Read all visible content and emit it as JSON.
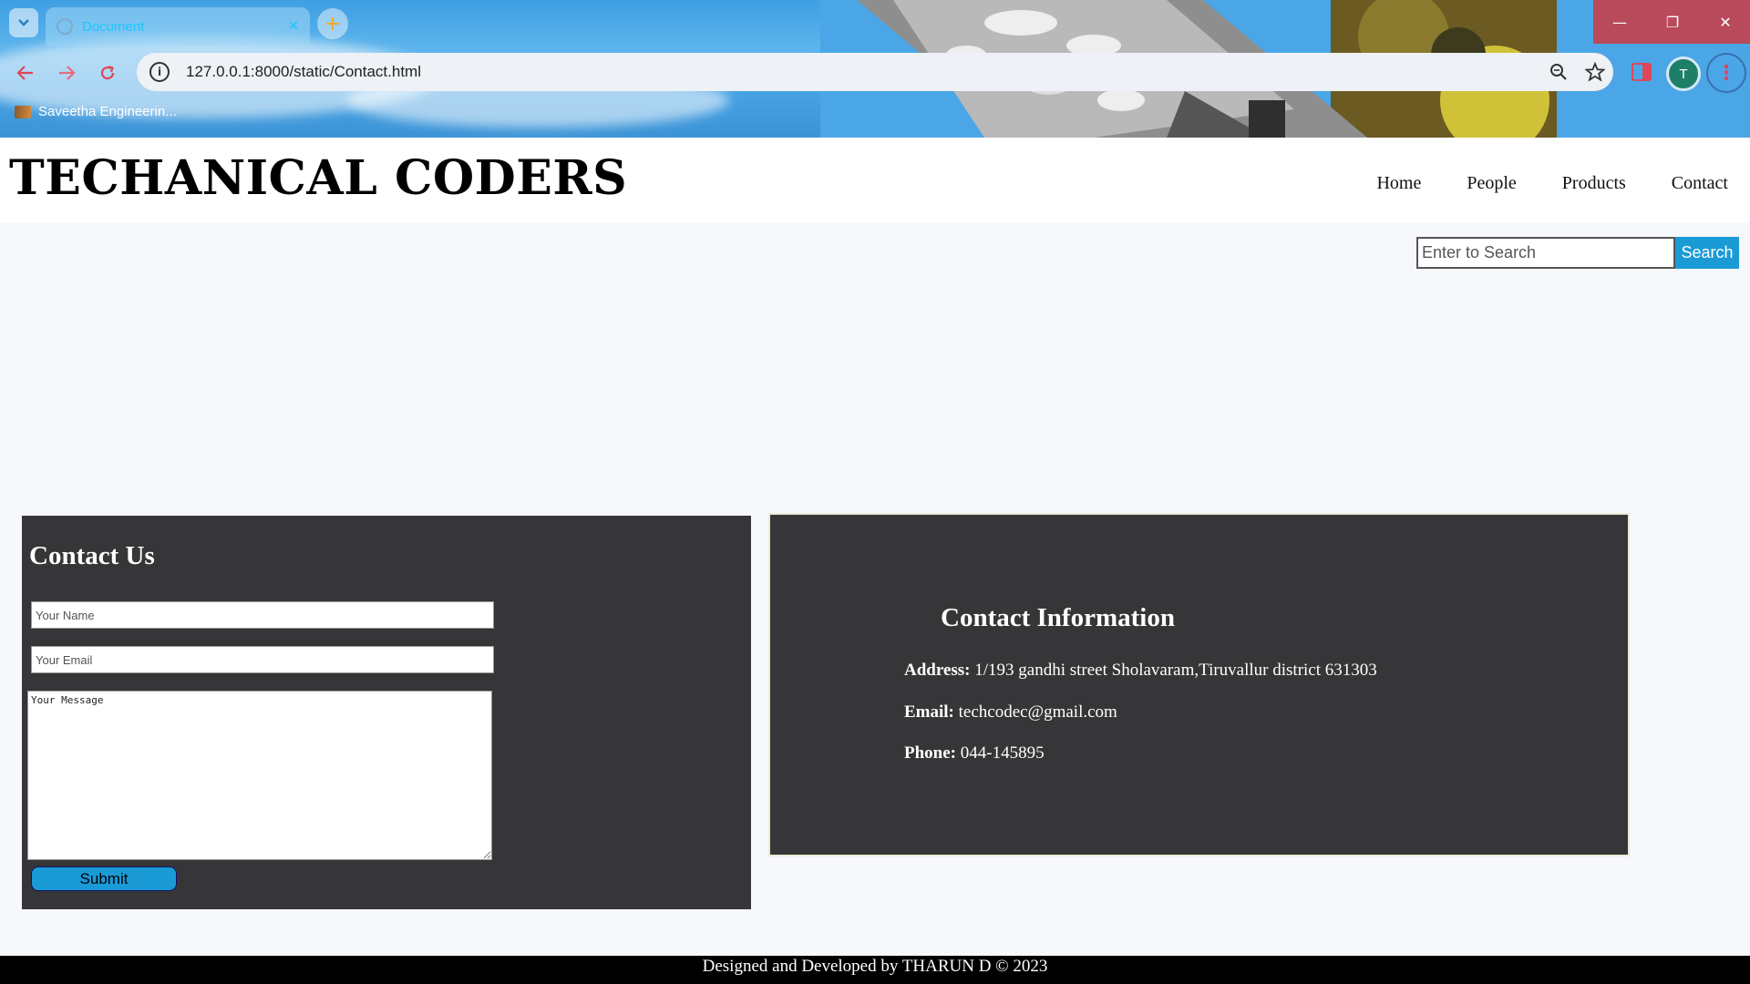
{
  "browser": {
    "tab_title": "Document",
    "tab_close": "✕",
    "new_tab": "+",
    "url": "127.0.0.1:8000/static/Contact.html",
    "bookmark_label": "Saveetha Engineerin...",
    "avatar_initial": "T",
    "window_controls": {
      "minimize": "—",
      "maximize": "❐",
      "close": "✕"
    },
    "icons": {
      "back": "arrow-left-icon",
      "forward": "arrow-right-icon",
      "reload": "reload-icon",
      "site_info": "info-icon",
      "zoom": "zoom-icon",
      "bookmark_star": "star-icon",
      "side_panel": "side-panel-icon",
      "menu": "kebab-menu-icon",
      "tab_search": "chevron-down-icon"
    },
    "accent": "#e0465a"
  },
  "site": {
    "brand": "TECHANICAL CODERS",
    "nav": [
      "Home",
      "People",
      "Products",
      "Contact"
    ],
    "search": {
      "placeholder": "Enter to Search",
      "button": "Search"
    }
  },
  "contact_form": {
    "title": "Contact Us",
    "name_placeholder": "Your Name",
    "email_placeholder": "Your Email",
    "message_placeholder": "Your Message",
    "submit": "Submit"
  },
  "contact_info": {
    "title": "Contact Information",
    "address_label": "Address:",
    "address_value": "1/193 gandhi street Sholavaram,Tiruvallur district 631303",
    "email_label": "Email:",
    "email_value": "techcodec@gmail.com",
    "phone_label": "Phone:",
    "phone_value": "044-145895"
  },
  "footer": {
    "text": "Designed and Developed by THARUN D © 2023"
  },
  "colors": {
    "primary_button": "#1a9bd6",
    "card_bg": "#363638",
    "footer_bg": "#000000"
  }
}
